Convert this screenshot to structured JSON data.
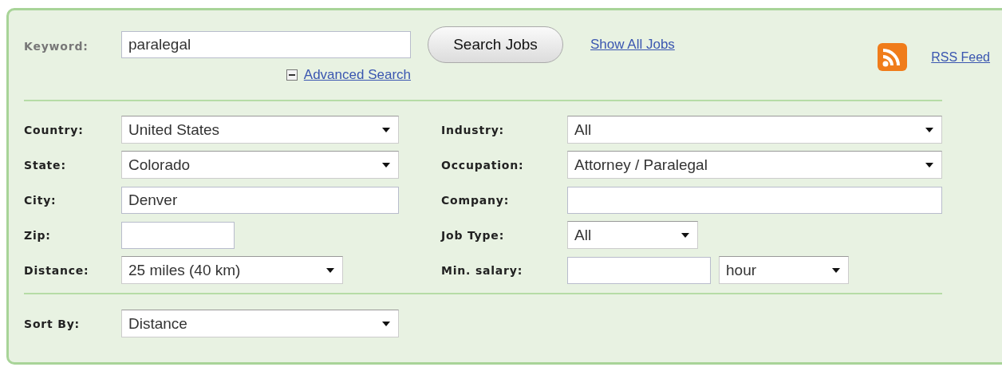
{
  "keyword": {
    "label": "Keyword:",
    "value": "paralegal"
  },
  "search_button": {
    "label": "Search Jobs"
  },
  "show_all_link": {
    "label": "Show All Jobs"
  },
  "rss_link": {
    "label": "RSS Feed"
  },
  "advanced_search": {
    "label": "Advanced Search",
    "expanded": true
  },
  "left_fields": [
    {
      "label": "Country:",
      "kind": "select",
      "value": "United States"
    },
    {
      "label": "State:",
      "kind": "select",
      "value": "Colorado"
    },
    {
      "label": "City:",
      "kind": "input",
      "value": "Denver"
    },
    {
      "label": "Zip:",
      "kind": "input"
    },
    {
      "label": "Distance:",
      "kind": "select",
      "value": "25 miles (40 km)"
    }
  ],
  "right_fields": [
    {
      "label": "Industry:",
      "kind": "select",
      "value": "All"
    },
    {
      "label": "Occupation:",
      "kind": "select",
      "value": "Attorney / Paralegal"
    },
    {
      "label": "Company:",
      "kind": "input"
    },
    {
      "label": "Job Type:",
      "kind": "select",
      "value": "All"
    },
    {
      "label": "Min. salary:",
      "kind": "input_unit",
      "unit": "hour"
    }
  ],
  "sort_by": {
    "label": "Sort By:",
    "value": "Distance"
  }
}
